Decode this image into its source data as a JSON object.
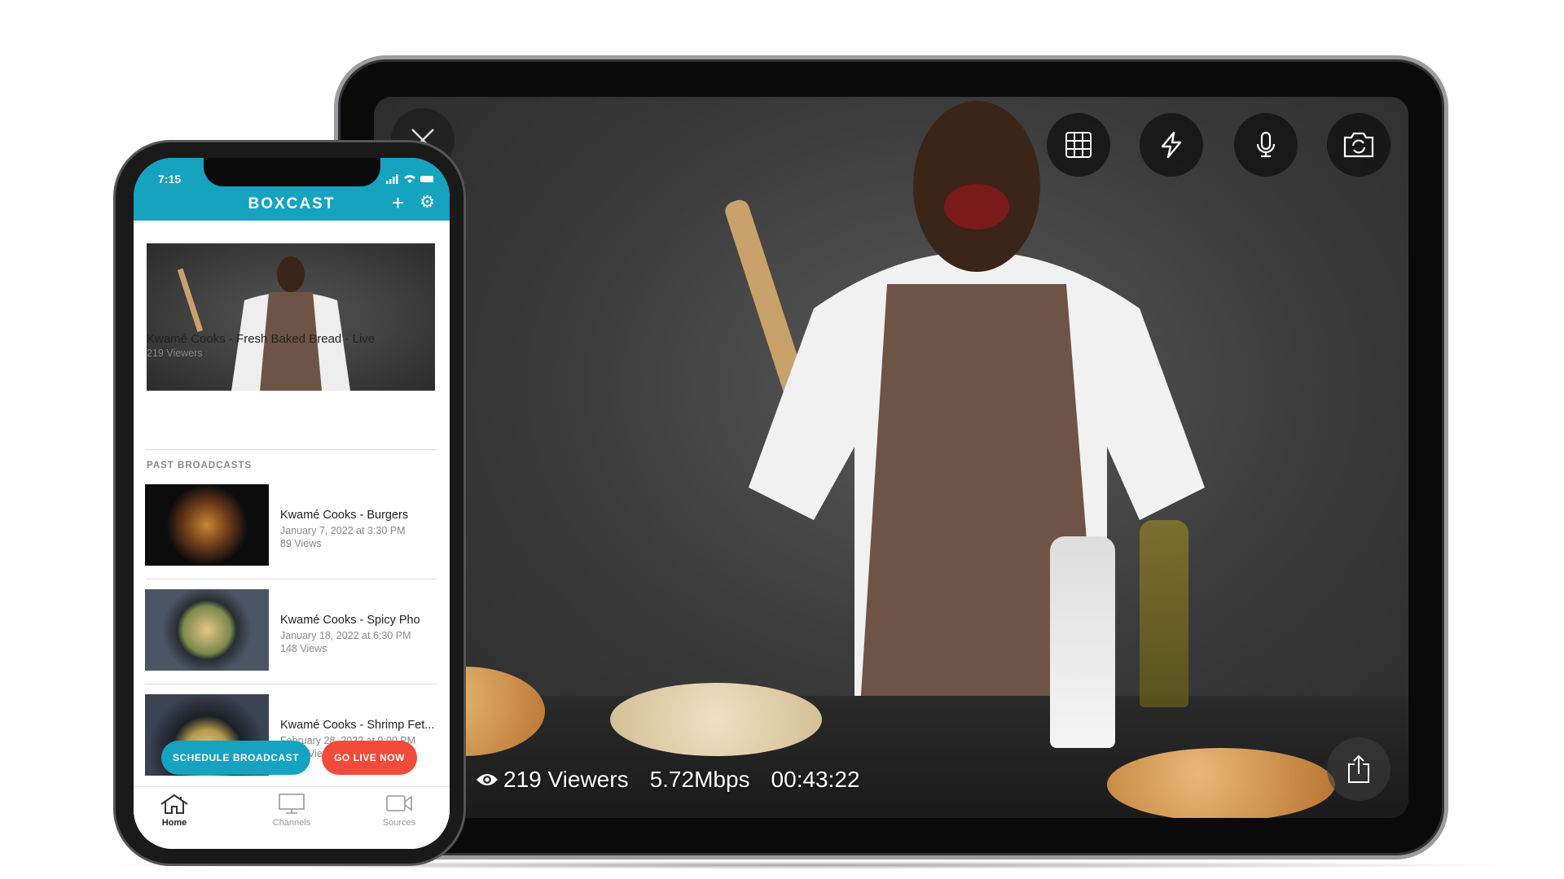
{
  "tablet": {
    "controls": [
      {
        "icon": "grid-icon"
      },
      {
        "icon": "flash-icon"
      },
      {
        "icon": "microphone-icon"
      },
      {
        "icon": "camera-flip-icon"
      }
    ],
    "close_icon": "close-icon",
    "share_icon": "share-icon",
    "stats": {
      "viewers": "219 Viewers",
      "bitrate": "5.72Mbps",
      "duration": "00:43:22"
    }
  },
  "phone": {
    "status": {
      "time": "7:15"
    },
    "header": {
      "logo": "BOXCAST",
      "add": "+",
      "settings": "⚙"
    },
    "live": {
      "title": "Kwamé Cooks - Fresh Baked Bread - Live",
      "viewers": "219 Viewers"
    },
    "section_label": "PAST BROADCASTS",
    "broadcasts": [
      {
        "title": "Kwamé Cooks - Burgers",
        "date": "January 7, 2022 at 3:30 PM",
        "views": "89 Views"
      },
      {
        "title": "Kwamé Cooks - Spicy Pho",
        "date": "January 18, 2022 at 6:30 PM",
        "views": "148 Views"
      },
      {
        "title": "Kwamé Cooks - Shrimp Fet...",
        "date": "February 28, 2022 at 9:00 PM",
        "views": "Views"
      }
    ],
    "buttons": {
      "schedule": "SCHEDULE BROADCAST",
      "go_live": "GO LIVE NOW"
    },
    "nav": [
      {
        "label": "Home",
        "active": true
      },
      {
        "label": "Channels"
      },
      {
        "label": "Sources"
      }
    ],
    "colors": {
      "brand": "#16a3bf",
      "live": "#f24b3b"
    }
  }
}
